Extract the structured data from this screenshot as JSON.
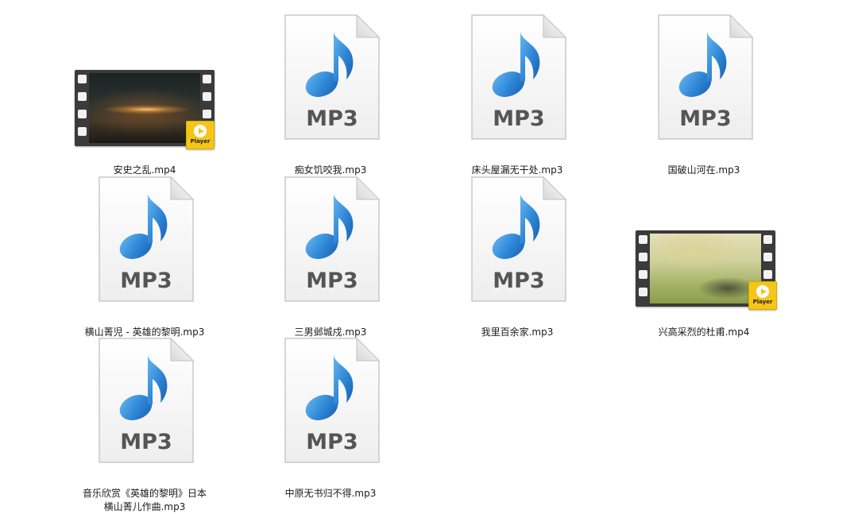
{
  "files": [
    {
      "name": "安史之乱.mp4",
      "type": "video",
      "icon": "video-thumbnail-icon",
      "badge": "Player"
    },
    {
      "name": "痴女饥咬我.mp3",
      "type": "audio",
      "icon": "mp3-file-icon",
      "icon_text": "MP3"
    },
    {
      "name": "床头屋漏无干处.mp3",
      "type": "audio",
      "icon": "mp3-file-icon",
      "icon_text": "MP3"
    },
    {
      "name": "国破山河在.mp3",
      "type": "audio",
      "icon": "mp3-file-icon",
      "icon_text": "MP3"
    },
    {
      "name": "横山菁児 - 英雄的黎明.mp3",
      "type": "audio",
      "icon": "mp3-file-icon",
      "icon_text": "MP3"
    },
    {
      "name": "三男邺城戍.mp3",
      "type": "audio",
      "icon": "mp3-file-icon",
      "icon_text": "MP3"
    },
    {
      "name": "我里百余家.mp3",
      "type": "audio",
      "icon": "mp3-file-icon",
      "icon_text": "MP3"
    },
    {
      "name": "兴高采烈的杜甫.mp4",
      "type": "video",
      "icon": "video-thumbnail-icon",
      "badge": "Player"
    },
    {
      "name": "音乐欣赏《英雄的黎明》日本\n横山菁儿作曲.mp3",
      "type": "audio",
      "icon": "mp3-file-icon",
      "icon_text": "MP3"
    },
    {
      "name": "中原无书归不得.mp3",
      "type": "audio",
      "icon": "mp3-file-icon",
      "icon_text": "MP3"
    }
  ],
  "colors": {
    "note_blue": "#2e86d6",
    "mp3_text": "#555555",
    "badge_yellow": "#f5c518"
  }
}
